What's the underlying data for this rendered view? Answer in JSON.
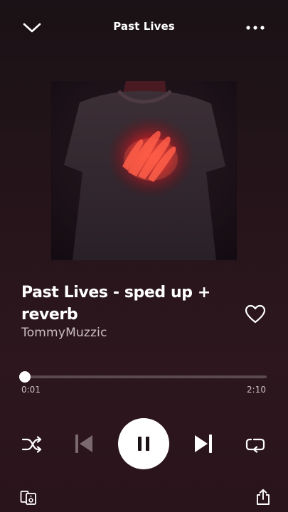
{
  "header": {
    "title": "Past Lives",
    "collapse_icon": "chevron-down-icon",
    "more_icon": "more-horizontal-icon"
  },
  "track": {
    "title": "Past Lives - sped up + reverb",
    "artist": "TommyMuzzic",
    "liked": false
  },
  "progress": {
    "elapsed": "0:01",
    "total": "2:10",
    "fraction": 0.008
  },
  "controls": {
    "shuffle_icon": "shuffle-icon",
    "previous_icon": "skip-previous-icon",
    "previous_enabled": false,
    "play_state": "playing",
    "pause_icon": "pause-icon",
    "next_icon": "skip-next-icon",
    "repeat_icon": "repeat-icon"
  },
  "footer": {
    "devices_icon": "connect-devices-icon",
    "share_icon": "share-icon"
  },
  "colors": {
    "background_top": "#1a1216",
    "background_bottom": "#2a141c",
    "text_primary": "#ffffff",
    "text_secondary": "#c9bfc4",
    "progress_track": "#5a4a50",
    "artwork_glow": "#ff2a2a"
  }
}
